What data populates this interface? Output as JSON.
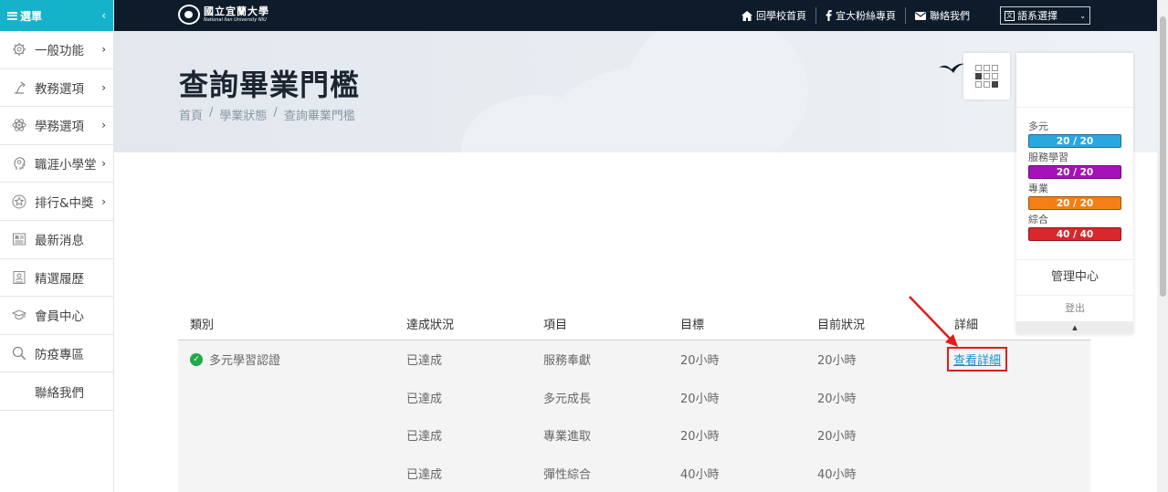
{
  "sidebar": {
    "title": "選單",
    "items": [
      {
        "label": "一般功能",
        "icon": "gear-icon",
        "has_submenu": true
      },
      {
        "label": "教務選項",
        "icon": "desk-lamp-icon",
        "has_submenu": true
      },
      {
        "label": "學務選項",
        "icon": "atom-icon",
        "has_submenu": true
      },
      {
        "label": "職涯小學堂",
        "icon": "head-gear-icon",
        "has_submenu": true
      },
      {
        "label": "排行&中獎",
        "icon": "star-badge-icon",
        "has_submenu": true
      },
      {
        "label": "最新消息",
        "icon": "newspaper-icon",
        "has_submenu": false
      },
      {
        "label": "精選履歷",
        "icon": "resume-icon",
        "has_submenu": false
      },
      {
        "label": "會員中心",
        "icon": "graduation-cap-icon",
        "has_submenu": false
      },
      {
        "label": "防疫專區",
        "icon": "magnifier-icon",
        "has_submenu": false
      },
      {
        "label": "聯絡我們",
        "icon": "",
        "has_submenu": false
      }
    ]
  },
  "topbar": {
    "logo_name": "國立宜蘭大學",
    "logo_sub": "National Ilan University NIU",
    "links": [
      {
        "label": "回學校首頁",
        "icon": "home-icon"
      },
      {
        "label": "宜大粉絲專頁",
        "icon": "facebook-icon"
      },
      {
        "label": "聯絡我們",
        "icon": "mail-icon"
      }
    ],
    "language_select": "語系選擇"
  },
  "banner": {
    "title": "查詢畢業門檻",
    "breadcrumb": [
      "首頁",
      "學業狀態",
      "查詢畢業門檻"
    ]
  },
  "panel": {
    "stats": [
      {
        "label": "多元",
        "value": "20 / 20",
        "color": "#29a8e0"
      },
      {
        "label": "服務學習",
        "value": "20 / 20",
        "color": "#a512b8"
      },
      {
        "label": "專業",
        "value": "20 / 20",
        "color": "#f47f16"
      },
      {
        "label": "綜合",
        "value": "40 / 40",
        "color": "#d9272b"
      }
    ],
    "admin": "管理中心",
    "logout": "登出"
  },
  "table": {
    "headers": [
      "類別",
      "達成狀況",
      "項目",
      "目標",
      "目前狀況",
      "詳細"
    ],
    "category": "多元學習認證",
    "detail_link": "查看詳細",
    "rows": [
      {
        "status": "已達成",
        "item": "服務奉獻",
        "target": "20小時",
        "current": "20小時"
      },
      {
        "status": "已達成",
        "item": "多元成長",
        "target": "20小時",
        "current": "20小時"
      },
      {
        "status": "已達成",
        "item": "專業進取",
        "target": "20小時",
        "current": "20小時"
      },
      {
        "status": "已達成",
        "item": "彈性綜合",
        "target": "40小時",
        "current": "40小時"
      }
    ]
  },
  "colors": {
    "sidebar_header": "#15b3c9",
    "topbar": "#0d1b2a",
    "success": "#22a94a",
    "highlight": "#e01d1d",
    "link": "#1a8fd1"
  }
}
